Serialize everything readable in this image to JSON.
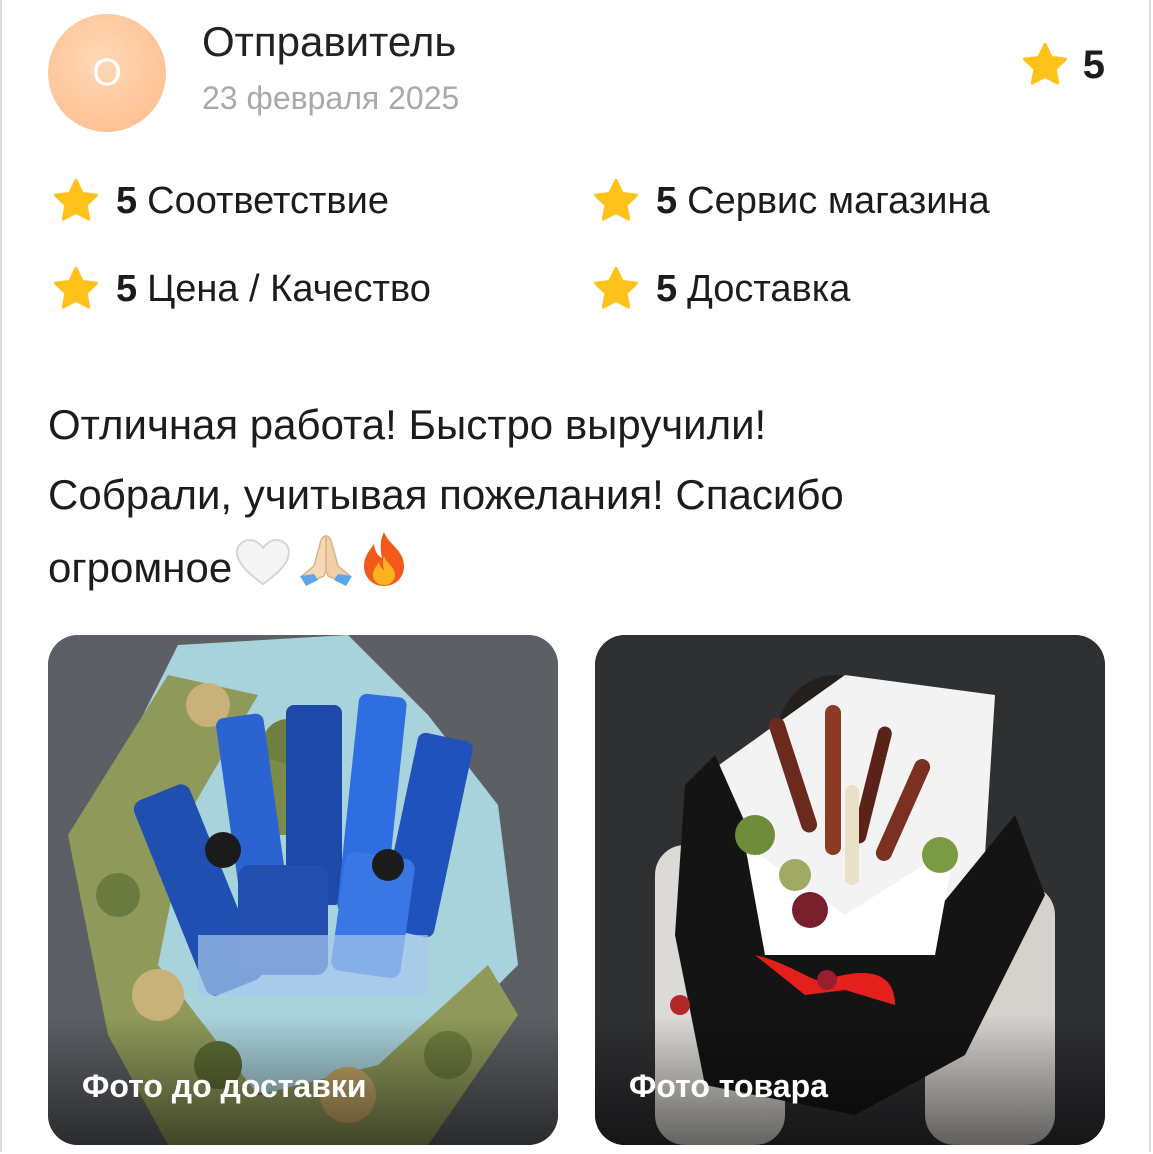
{
  "review": {
    "avatar_letter": "О",
    "sender": "Отправитель",
    "date": "23 февраля 2025",
    "overall_rating": "5",
    "criteria": [
      {
        "score": "5",
        "label": "Соответствие"
      },
      {
        "score": "5",
        "label": "Сервис магазина"
      },
      {
        "score": "5",
        "label": "Цена / Качество"
      },
      {
        "score": "5",
        "label": "Доставка"
      }
    ],
    "text_lines": [
      "Отличная работа! Быстро выручили!",
      "Собрали, учитывая пожелания! Спасибо",
      "огромное"
    ],
    "emojis": [
      "white-heart-icon",
      "praying-hands-icon",
      "fire-icon"
    ]
  },
  "photos": [
    {
      "caption": "Фото до доставки"
    },
    {
      "caption": "Фото товара"
    }
  ],
  "colors": {
    "star": "#ffc21a",
    "avatar": "#ffc7a0",
    "date_text": "#a9a9a9"
  }
}
